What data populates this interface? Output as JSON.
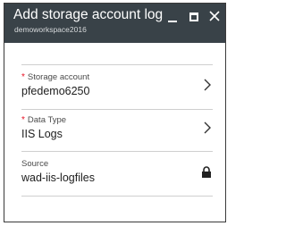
{
  "blade": {
    "title": "Add storage account log",
    "subtitle": "demoworkspace2016",
    "controls": {
      "minimize_icon": "minimize-icon",
      "maximize_icon": "maximize-icon",
      "close_icon": "close-icon"
    }
  },
  "fields": {
    "storage_account": {
      "required_mark": "*",
      "label": "Storage account",
      "value": "pfedemo6250",
      "icon": "chevron-right-icon"
    },
    "data_type": {
      "required_mark": "*",
      "label": "Data Type",
      "value": "IIS Logs",
      "icon": "chevron-right-icon"
    },
    "source": {
      "label": "Source",
      "value": "wad-iis-logfiles",
      "icon": "lock-icon"
    }
  },
  "colors": {
    "header_background": "#394248",
    "required_marker": "#e81123",
    "border": "#3a3a3a"
  }
}
